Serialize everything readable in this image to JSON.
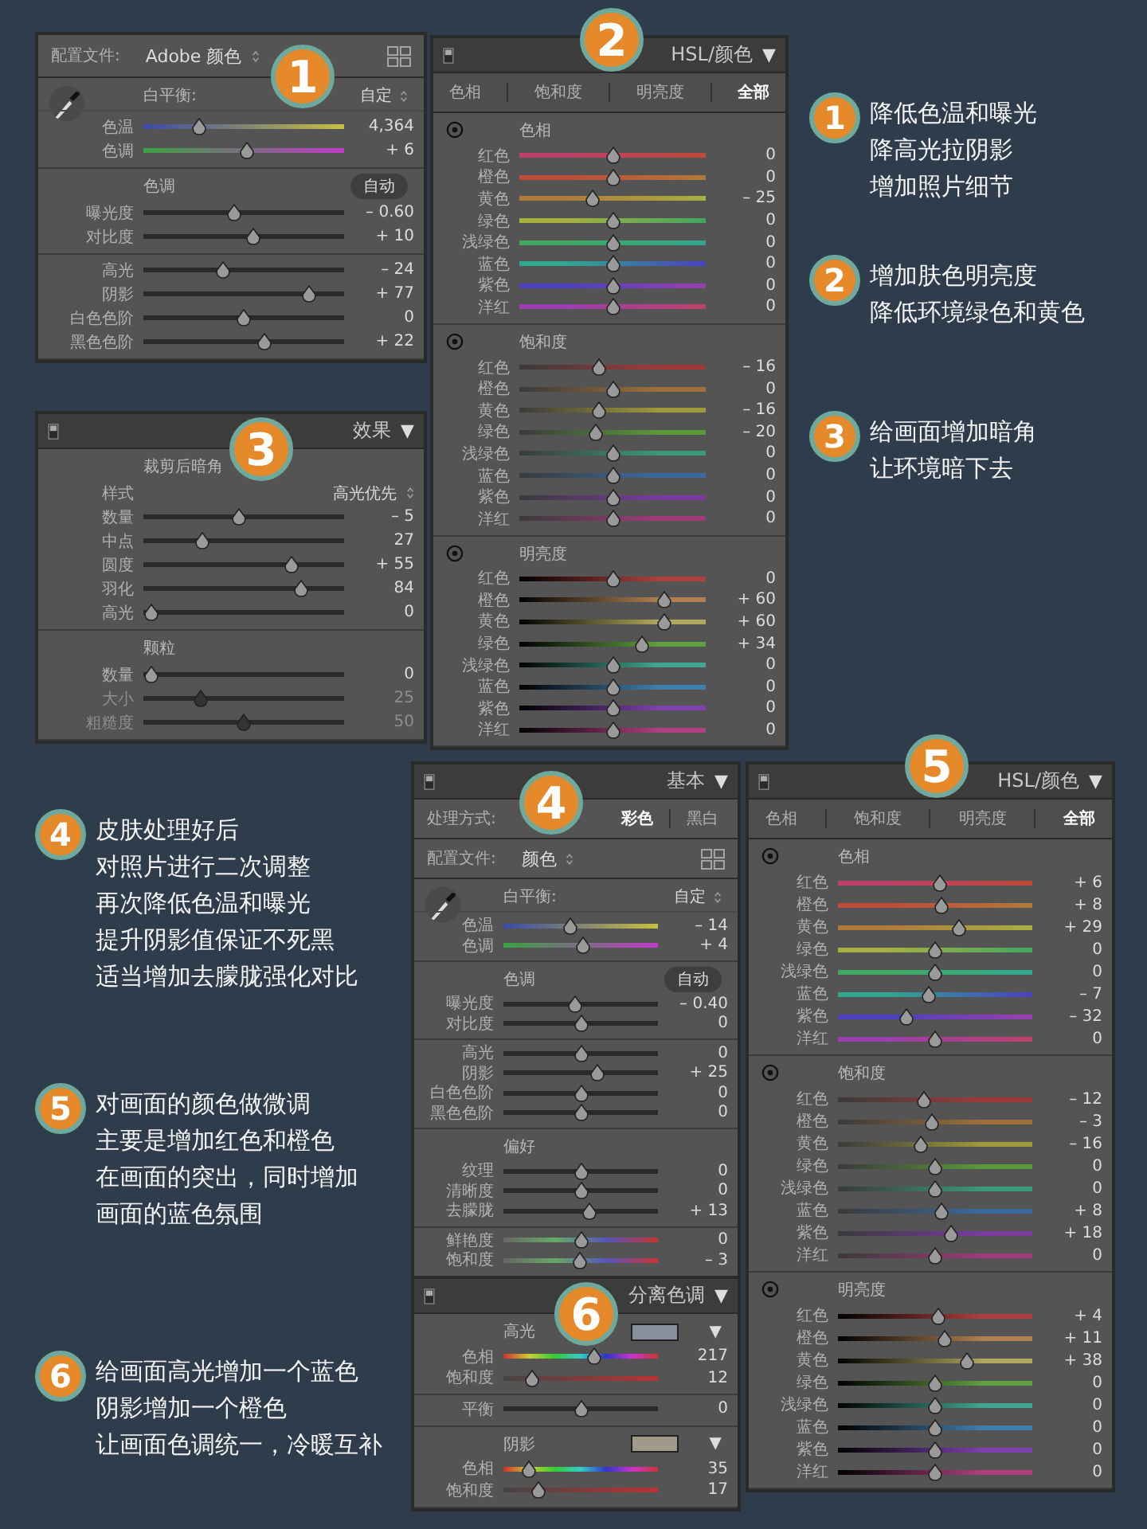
{
  "panels": [
    {
      "badge": "1",
      "profile": {
        "label": "配置文件:",
        "value": "Adobe 颜色"
      },
      "sections": [
        {
          "wb": {
            "label": "白平衡:",
            "value": "自定"
          },
          "sliders": [
            {
              "label": "色温",
              "value": "4,364",
              "level": 0.26,
              "kind": "temp"
            },
            {
              "label": "色调",
              "value": "+ 6",
              "level": 0.52,
              "kind": "tint"
            }
          ]
        },
        {
          "title": "色调",
          "button": "自动",
          "sliders": [
            {
              "label": "曝光度",
              "value": "– 0.60",
              "level": 0.45,
              "kind": "plain"
            },
            {
              "label": "对比度",
              "value": "+ 10",
              "level": 0.55,
              "kind": "plain"
            }
          ]
        },
        {
          "sliders": [
            {
              "label": "高光",
              "value": "– 24",
              "level": 0.39,
              "kind": "plain"
            },
            {
              "label": "阴影",
              "value": "+ 77",
              "level": 0.85,
              "kind": "plain"
            },
            {
              "label": "白色色阶",
              "value": "0",
              "level": 0.5,
              "kind": "plain"
            },
            {
              "label": "黑色色阶",
              "value": "+ 22",
              "level": 0.61,
              "kind": "plain"
            }
          ]
        }
      ]
    },
    {
      "badge": "3",
      "header": {
        "title": "效果",
        "caret": "▼"
      },
      "sections": [
        {
          "title": "裁剪后暗角",
          "select": {
            "label": "样式",
            "value": "高光优先"
          },
          "sliders": [
            {
              "label": "数量",
              "value": "– 5",
              "level": 0.47,
              "kind": "plain"
            },
            {
              "label": "中点",
              "value": "27",
              "level": 0.28,
              "kind": "plain"
            },
            {
              "label": "圆度",
              "value": "+ 55",
              "level": 0.76,
              "kind": "plain"
            },
            {
              "label": "羽化",
              "value": "84",
              "level": 0.81,
              "kind": "plain"
            },
            {
              "label": "高光",
              "value": "0",
              "level": 0.0,
              "kind": "plain"
            }
          ]
        },
        {
          "title": "颗粒",
          "sliders": [
            {
              "label": "数量",
              "value": "0",
              "level": 0.0,
              "kind": "plain",
              "disabled": false
            },
            {
              "label": "大小",
              "value": "25",
              "level": 0.27,
              "kind": "plain",
              "disabled": true
            },
            {
              "label": "粗糙度",
              "value": "50",
              "level": 0.5,
              "kind": "plain",
              "disabled": true
            }
          ]
        }
      ]
    },
    {
      "badge": "2",
      "header": {
        "title": "HSL/颜色",
        "caret": "▼"
      },
      "tabs": [
        {
          "label": "色相",
          "selected": false
        },
        {
          "label": "饱和度",
          "selected": false
        },
        {
          "label": "明亮度",
          "selected": false
        },
        {
          "label": "全部",
          "selected": true
        }
      ],
      "sections": [
        {
          "title": "色相",
          "sliders": [
            {
              "label": "红色",
              "value": "0",
              "level": 0.5,
              "kind": "hue",
              "color": "#c0406a"
            },
            {
              "label": "橙色",
              "value": "0",
              "level": 0.5,
              "kind": "hue",
              "color": "#c04a3a"
            },
            {
              "label": "黄色",
              "value": "– 25",
              "level": 0.38,
              "kind": "hue",
              "color": "#b07a3a"
            },
            {
              "label": "绿色",
              "value": "0",
              "level": 0.5,
              "kind": "hue",
              "color": "#a8b040"
            },
            {
              "label": "浅绿色",
              "value": "0",
              "level": 0.5,
              "kind": "hue",
              "color": "#40a860"
            },
            {
              "label": "蓝色",
              "value": "0",
              "level": 0.5,
              "kind": "hue",
              "color": "#30a890"
            },
            {
              "label": "紫色",
              "value": "0",
              "level": 0.5,
              "kind": "hue",
              "color": "#4a40c0"
            },
            {
              "label": "洋红",
              "value": "0",
              "level": 0.5,
              "kind": "hue",
              "color": "#9a40b0"
            }
          ]
        },
        {
          "title": "饱和度",
          "sliders": [
            {
              "label": "红色",
              "value": "– 16",
              "level": 0.42,
              "kind": "sat",
              "color": "#a03a3a"
            },
            {
              "label": "橙色",
              "value": "0",
              "level": 0.5,
              "kind": "sat",
              "color": "#a0703a"
            },
            {
              "label": "黄色",
              "value": "– 16",
              "level": 0.42,
              "kind": "sat",
              "color": "#a09a3a"
            },
            {
              "label": "绿色",
              "value": "– 20",
              "level": 0.4,
              "kind": "sat",
              "color": "#5a9a3a"
            },
            {
              "label": "浅绿色",
              "value": "0",
              "level": 0.5,
              "kind": "sat",
              "color": "#3a9a7a"
            },
            {
              "label": "蓝色",
              "value": "0",
              "level": 0.5,
              "kind": "sat",
              "color": "#3a6aa0"
            },
            {
              "label": "紫色",
              "value": "0",
              "level": 0.5,
              "kind": "sat",
              "color": "#7a3aa0"
            },
            {
              "label": "洋红",
              "value": "0",
              "level": 0.5,
              "kind": "sat",
              "color": "#a03a7a"
            }
          ]
        },
        {
          "title": "明亮度",
          "sliders": [
            {
              "label": "红色",
              "value": "0",
              "level": 0.5,
              "kind": "lum",
              "color": "#b04040"
            },
            {
              "label": "橙色",
              "value": "+ 60",
              "level": 0.8,
              "kind": "lum",
              "color": "#b08050"
            },
            {
              "label": "黄色",
              "value": "+ 60",
              "level": 0.8,
              "kind": "lum",
              "color": "#b0a860"
            },
            {
              "label": "绿色",
              "value": "+ 34",
              "level": 0.67,
              "kind": "lum",
              "color": "#60a040"
            },
            {
              "label": "浅绿色",
              "value": "0",
              "level": 0.5,
              "kind": "lum",
              "color": "#40a890"
            },
            {
              "label": "蓝色",
              "value": "0",
              "level": 0.5,
              "kind": "lum",
              "color": "#4080b0"
            },
            {
              "label": "紫色",
              "value": "0",
              "level": 0.5,
              "kind": "lum",
              "color": "#8040b0"
            },
            {
              "label": "洋红",
              "value": "0",
              "level": 0.5,
              "kind": "lum",
              "color": "#b04080"
            }
          ]
        }
      ]
    },
    {
      "badge": "4",
      "header": {
        "title": "基本",
        "caret": "▼"
      },
      "treatment": {
        "label": "处理方式:",
        "options": [
          {
            "label": "彩色",
            "selected": true
          },
          {
            "label": "黑白",
            "selected": false
          }
        ]
      },
      "profile": {
        "label": "配置文件:",
        "value": "颜色"
      },
      "sections": [
        {
          "wb": {
            "label": "白平衡:",
            "value": "自定"
          },
          "sliders": [
            {
              "label": "色温",
              "value": "– 14",
              "level": 0.43,
              "kind": "temp"
            },
            {
              "label": "色调",
              "value": "+ 4",
              "level": 0.52,
              "kind": "tint"
            }
          ]
        },
        {
          "title": "色调",
          "button": "自动",
          "sliders": [
            {
              "label": "曝光度",
              "value": "– 0.40",
              "level": 0.46,
              "kind": "plain"
            },
            {
              "label": "对比度",
              "value": "0",
              "level": 0.5,
              "kind": "plain"
            }
          ]
        },
        {
          "sliders": [
            {
              "label": "高光",
              "value": "0",
              "level": 0.5,
              "kind": "plain"
            },
            {
              "label": "阴影",
              "value": "+ 25",
              "level": 0.62,
              "kind": "plain"
            },
            {
              "label": "白色色阶",
              "value": "0",
              "level": 0.5,
              "kind": "plain"
            },
            {
              "label": "黑色色阶",
              "value": "0",
              "level": 0.5,
              "kind": "plain"
            }
          ]
        },
        {
          "title": "偏好",
          "sliders": [
            {
              "label": "纹理",
              "value": "0",
              "level": 0.5,
              "kind": "plain"
            },
            {
              "label": "清晰度",
              "value": "0",
              "level": 0.5,
              "kind": "plain"
            },
            {
              "label": "去朦胧",
              "value": "+ 13",
              "level": 0.56,
              "kind": "plain"
            }
          ]
        },
        {
          "sliders": [
            {
              "label": "鲜艳度",
              "value": "0",
              "level": 0.5,
              "kind": "spectrum"
            },
            {
              "label": "饱和度",
              "value": "– 3",
              "level": 0.49,
              "kind": "spectrum"
            }
          ]
        }
      ]
    },
    {
      "badge": "6",
      "header": {
        "title": "分离色调",
        "caret": "▼"
      },
      "sections": [
        {
          "title": "高光",
          "swatch": {
            "color": "#8a8fa0",
            "caret": "▼"
          },
          "sliders": [
            {
              "label": "色相",
              "value": "217",
              "level": 0.6,
              "kind": "splithue"
            },
            {
              "label": "饱和度",
              "value": "12",
              "level": 0.15,
              "kind": "splitsat"
            }
          ]
        },
        {
          "sliders": [
            {
              "label": "平衡",
              "value": "0",
              "level": 0.5,
              "kind": "plain"
            }
          ]
        },
        {
          "title": "阴影",
          "swatch": {
            "color": "#a09a8a",
            "caret": "▼"
          },
          "sliders": [
            {
              "label": "色相",
              "value": "35",
              "level": 0.13,
              "kind": "splithue"
            },
            {
              "label": "饱和度",
              "value": "17",
              "level": 0.2,
              "kind": "splitsat"
            }
          ]
        }
      ]
    },
    {
      "badge": "5",
      "header": {
        "title": "HSL/颜色",
        "caret": "▼"
      },
      "tabs": [
        {
          "label": "色相",
          "selected": false
        },
        {
          "label": "饱和度",
          "selected": false
        },
        {
          "label": "明亮度",
          "selected": false
        },
        {
          "label": "全部",
          "selected": true
        }
      ],
      "sections": [
        {
          "title": "色相",
          "sliders": [
            {
              "label": "红色",
              "value": "+ 6",
              "level": 0.53,
              "kind": "hue",
              "color": "#c0406a"
            },
            {
              "label": "橙色",
              "value": "+ 8",
              "level": 0.54,
              "kind": "hue",
              "color": "#c04a3a"
            },
            {
              "label": "黄色",
              "value": "+ 29",
              "level": 0.63,
              "kind": "hue",
              "color": "#b07a3a"
            },
            {
              "label": "绿色",
              "value": "0",
              "level": 0.5,
              "kind": "hue",
              "color": "#a8b040"
            },
            {
              "label": "浅绿色",
              "value": "0",
              "level": 0.5,
              "kind": "hue",
              "color": "#40a860"
            },
            {
              "label": "蓝色",
              "value": "– 7",
              "level": 0.46,
              "kind": "hue",
              "color": "#30a890"
            },
            {
              "label": "紫色",
              "value": "– 32",
              "level": 0.34,
              "kind": "hue",
              "color": "#4a40c0"
            },
            {
              "label": "洋红",
              "value": "0",
              "level": 0.5,
              "kind": "hue",
              "color": "#9a40b0"
            }
          ]
        },
        {
          "title": "饱和度",
          "sliders": [
            {
              "label": "红色",
              "value": "– 12",
              "level": 0.44,
              "kind": "sat",
              "color": "#a03a3a"
            },
            {
              "label": "橙色",
              "value": "– 3",
              "level": 0.48,
              "kind": "sat",
              "color": "#a0703a"
            },
            {
              "label": "黄色",
              "value": "– 16",
              "level": 0.42,
              "kind": "sat",
              "color": "#a09a3a"
            },
            {
              "label": "绿色",
              "value": "0",
              "level": 0.5,
              "kind": "sat",
              "color": "#5a9a3a"
            },
            {
              "label": "浅绿色",
              "value": "0",
              "level": 0.5,
              "kind": "sat",
              "color": "#3a9a7a"
            },
            {
              "label": "蓝色",
              "value": "+ 8",
              "level": 0.54,
              "kind": "sat",
              "color": "#3a6aa0"
            },
            {
              "label": "紫色",
              "value": "+ 18",
              "level": 0.59,
              "kind": "sat",
              "color": "#7a3aa0"
            },
            {
              "label": "洋红",
              "value": "0",
              "level": 0.5,
              "kind": "sat",
              "color": "#a03a7a"
            }
          ]
        },
        {
          "title": "明亮度",
          "sliders": [
            {
              "label": "红色",
              "value": "+ 4",
              "level": 0.52,
              "kind": "lum",
              "color": "#b04040"
            },
            {
              "label": "橙色",
              "value": "+ 11",
              "level": 0.55,
              "kind": "lum",
              "color": "#b08050"
            },
            {
              "label": "黄色",
              "value": "+ 38",
              "level": 0.68,
              "kind": "lum",
              "color": "#b0a860"
            },
            {
              "label": "绿色",
              "value": "0",
              "level": 0.5,
              "kind": "lum",
              "color": "#60a040"
            },
            {
              "label": "浅绿色",
              "value": "0",
              "level": 0.5,
              "kind": "lum",
              "color": "#40a890"
            },
            {
              "label": "蓝色",
              "value": "0",
              "level": 0.5,
              "kind": "lum",
              "color": "#4080b0"
            },
            {
              "label": "紫色",
              "value": "0",
              "level": 0.5,
              "kind": "lum",
              "color": "#8040b0"
            },
            {
              "label": "洋红",
              "value": "0",
              "level": 0.5,
              "kind": "lum",
              "color": "#b04080"
            }
          ]
        }
      ]
    }
  ],
  "notes": [
    {
      "badge": "1",
      "lines": [
        "降低色温和曝光",
        "降高光拉阴影",
        "增加照片细节"
      ]
    },
    {
      "badge": "2",
      "lines": [
        "增加肤色明亮度",
        "降低环境绿色和黄色"
      ]
    },
    {
      "badge": "3",
      "lines": [
        "给画面增加暗角",
        "让环境暗下去"
      ]
    },
    {
      "badge": "4",
      "lines": [
        "皮肤处理好后",
        "对照片进行二次调整",
        "再次降低色温和曝光",
        "提升阴影值保证不死黑",
        "适当增加去朦胧强化对比"
      ]
    },
    {
      "badge": "5",
      "lines": [
        "对画面的颜色做微调",
        "主要是增加红色和橙色",
        "在画面的突出，同时增加",
        "画面的蓝色氛围"
      ]
    },
    {
      "badge": "6",
      "lines": [
        "给画面高光增加一个蓝色",
        "阴影增加一个橙色",
        "让画面色调统一，冷暖互补"
      ]
    }
  ]
}
